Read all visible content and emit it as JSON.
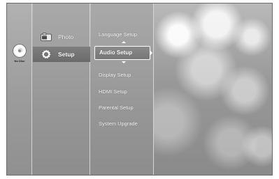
{
  "disc": {
    "status_label": "No Disc",
    "icon": "disc-icon"
  },
  "categories": [
    {
      "label": "Photo",
      "icon": "photo-icon",
      "selected": false
    },
    {
      "label": "Setup",
      "icon": "gear-icon",
      "selected": true
    }
  ],
  "setup_menu": {
    "items": [
      {
        "label": "Language Setup",
        "selected": false
      },
      {
        "label": "Audio Setup",
        "selected": true
      },
      {
        "label": "Display Setup",
        "selected": false
      },
      {
        "label": "HDMI Setup",
        "selected": false
      },
      {
        "label": "Parental Setup",
        "selected": false
      },
      {
        "label": "System Upgrade",
        "selected": false
      }
    ]
  },
  "colors": {
    "highlight_border": "#ffffff",
    "menu_text": "#ffffff",
    "panel_gray": "#9a9a9a"
  }
}
